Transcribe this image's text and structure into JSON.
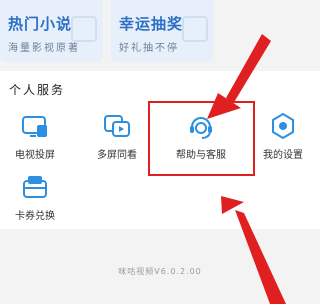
{
  "promos": [
    {
      "title": "热门小说",
      "subtitle": "海量影视原著"
    },
    {
      "title": "幸运抽奖",
      "subtitle": "好礼抽不停"
    }
  ],
  "section_title": "个人服务",
  "services": [
    {
      "label": "电视投屏",
      "icon": "tv-cast-icon"
    },
    {
      "label": "多屏同看",
      "icon": "multi-screen-icon"
    },
    {
      "label": "帮助与客服",
      "icon": "customer-service-headset-icon"
    },
    {
      "label": "我的设置",
      "icon": "settings-gear-icon"
    },
    {
      "label": "卡券兑换",
      "icon": "coupon-wallet-icon"
    }
  ],
  "footer": {
    "version": "咪咕视频V6.0.2.00"
  },
  "colors": {
    "accent": "#2c8fe0",
    "highlight": "#e02020"
  }
}
